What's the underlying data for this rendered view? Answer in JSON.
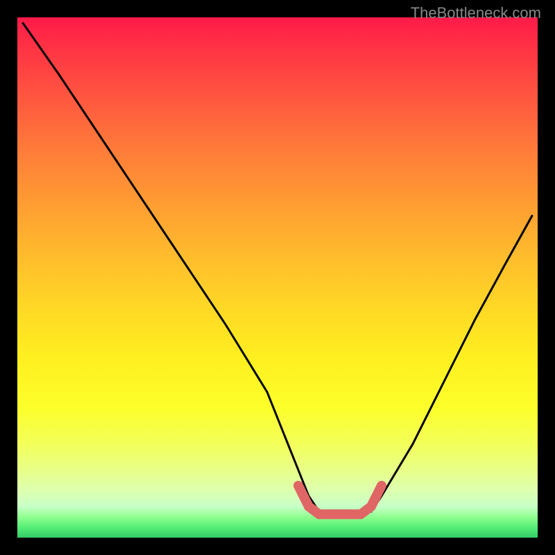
{
  "watermark": "TheBottleneck.com",
  "chart_data": {
    "type": "line",
    "title": "",
    "xlabel": "",
    "ylabel": "",
    "xlim": [
      0,
      100
    ],
    "ylim": [
      0,
      100
    ],
    "series": [
      {
        "name": "curve-black",
        "color": "#000000",
        "x": [
          1,
          8,
          16,
          24,
          32,
          40,
          48,
          54,
          56,
          58,
          64,
          68,
          70,
          76,
          82,
          88,
          94,
          99
        ],
        "values": [
          99,
          89,
          77,
          65,
          53,
          41,
          28,
          13,
          8,
          5,
          5,
          5,
          8,
          18,
          30,
          42,
          53,
          62
        ]
      },
      {
        "name": "flat-red-segment",
        "color": "#e06666",
        "x": [
          54,
          56,
          58,
          60,
          62,
          64,
          66,
          68,
          70
        ],
        "values": [
          10,
          6,
          4.5,
          4.5,
          4.5,
          4.5,
          4.5,
          6,
          10
        ]
      }
    ],
    "gradient_stops": [
      {
        "pos": 0,
        "color": "#ff1a4a"
      },
      {
        "pos": 25,
        "color": "#ff7a3a"
      },
      {
        "pos": 55,
        "color": "#ffd626"
      },
      {
        "pos": 82,
        "color": "#f3ff5a"
      },
      {
        "pos": 96,
        "color": "#90ff90"
      },
      {
        "pos": 100,
        "color": "#33cc66"
      }
    ]
  }
}
